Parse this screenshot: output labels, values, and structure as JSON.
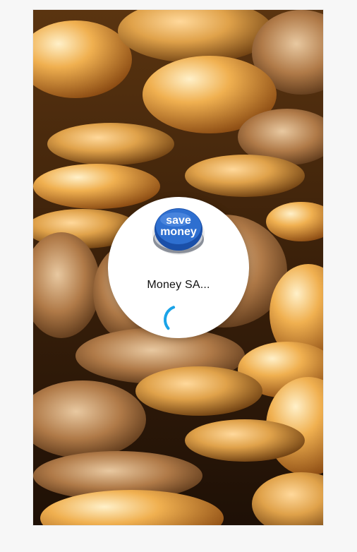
{
  "splash": {
    "app_name": "Money SA...",
    "logo_text_line1": "save",
    "logo_text_line2": "money",
    "background_image": "coins-pile",
    "logo_icon": "save-money-button-icon",
    "loading_icon": "loading-spinner-icon"
  },
  "colors": {
    "logo_blue": "#1f57b3",
    "spinner": "#1aa3e8",
    "card": "#ffffff",
    "coin_gold": "#d39a3c"
  }
}
